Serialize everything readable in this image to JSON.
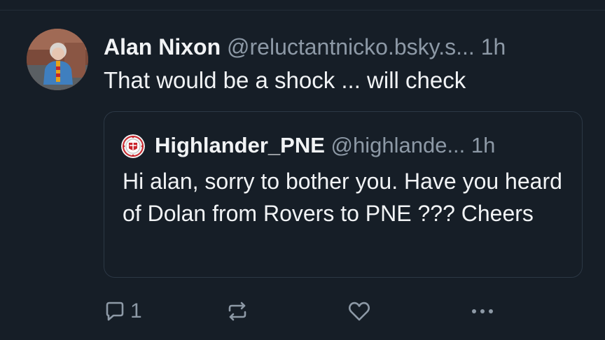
{
  "post": {
    "author_name": "Alan Nixon",
    "author_handle": "@reluctantnicko.bsky.s...",
    "timestamp": "1h",
    "text": "That would be a shock ... will check",
    "avatar_icon": "avatar-photo"
  },
  "quoted_post": {
    "author_name": "Highlander_PNE",
    "author_handle": "@highlande...",
    "timestamp": "1h",
    "text": "Hi alan, sorry to bother you. Have you heard of Dolan  from Rovers to PNE ??? Cheers",
    "avatar_icon": "club-crest-avatar"
  },
  "actions": {
    "reply_count": "1",
    "reply_icon": "reply-icon",
    "repost_icon": "repost-icon",
    "like_icon": "heart-icon",
    "more_icon": "more-icon"
  },
  "colors": {
    "background": "#161e27",
    "text": "#f1f3f5",
    "muted": "#8d99a6",
    "border": "#2c3845"
  }
}
